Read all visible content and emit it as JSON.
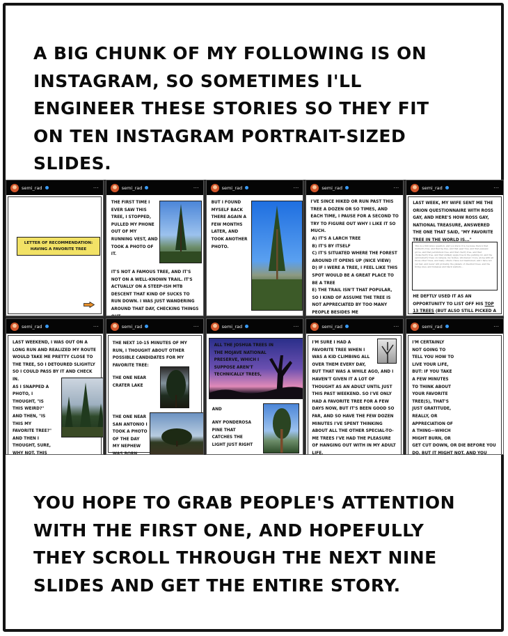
{
  "caption_top": "A big chunk of my following is on Instagram, so sometimes I'll engineer these stories so they fit on ten Instagram portrait-sized slides.",
  "caption_bottom": "You hope to grab people's attention with the first one, and hopefully they scroll through the next nine slides and get the entire story.",
  "instagram": {
    "username": "semi_rad",
    "verified": true,
    "more_icon": "⋯"
  },
  "slides": [
    {
      "title_line1": "Letter of recommendation:",
      "title_line2": "Having a favorite tree",
      "next_icon": "arrow-right"
    },
    {
      "text_a": "The first time I ever saw this tree, I stopped, pulled my phone out of my running vest, and took a photo of it.",
      "text_b": "It's not a famous tree, and it's not on a well-known trail. It's actually on a steep-ish MTB descent that kind of sucks to run down. I was just wandering around that day, checking things out."
    },
    {
      "text_a": "But I found myself back there again a few months later, and took another photo."
    },
    {
      "intro": "I've since hiked or run past this tree a dozen or so times, and each time, I pause for a second to try to figure out why I like it so much.",
      "reasons": [
        "A) It's a larch tree",
        "B) It's by itself",
        "C) It's situated where the forest around it opens up (nice view)",
        "D) If I were a tree, I feel like this spot would be a great place to be a tree",
        "E) The trail isn't that popular, so I kind of assume the tree is not appreciated by too many people besides me"
      ]
    },
    {
      "text_a": "Last week, my wife sent me the Orion questionnaire with Ross Gay, and here's how Ross Gay, national treasure, answered the one that said, \"My favorite tree in the world is...\"",
      "quote": "This is a ridiculous question, and you know it is, because there's that mulberry tree, and that fig tree, and that pear tree, and that pawpaw grove, and that persimmon tree, and that cherry tree, and that chokecherry tree, and that unlikely apple tree in the parking lot, and the serviceberry trees on campus, my hodies, whomever, I love, along with all those other trees, and many others I have not mentioned, and I have not yet met, and never will probably, the planets of chestnut trees, and the living ones, and hulasses and black walnuts...",
      "text_b_1": "He deftly used it as an opportunity to list off his ",
      "text_b_ul": "top 13 trees",
      "text_b_2": " (but also still picked a favorite)."
    },
    {
      "text_a": "Last weekend, I was out on a long run and realized my route would take me pretty close to the tree, so I detoured slightly so I could pass by it and check in.",
      "text_b": "As I snapped a photo, I thought, \"Is this weird?\" and then, \"Is this my favorite tree?\" and then I thought, sure, why not. This is my favorite tree."
    },
    {
      "text_a": "The next 10-15 minutes of my run, I thought about other possible candidates for my favorite tree:",
      "candidate_1": "The one near Crater Lake",
      "candidate_2": "The one near San Antonio I took a photo of the day my nephew was born"
    },
    {
      "text_a": "All the Joshua trees in the Mojave National Preserve, which I suppose aren't technically trees,",
      "text_and": "and",
      "text_b": "any Ponderosa pine that catches the light just right"
    },
    {
      "text_a": "I'm sure I had a favorite tree when I was a kid climbing all over them every day, but that was a while ago, and I haven't given it a lot of thought as an adult until just this past weekend. So I've only had a favorite tree for a few days now, but it's been good so far, and so have the few dozen minutes I've spent thinking about all the other special-to-me trees I've had the pleasure of hanging out with in my adult life."
    },
    {
      "text_a": "I'm certainly not going to tell you how to live your life, but: if you take a few minutes to think about your favorite tree(s), that's just gratitude, really, or appreciation of a thing—which might burn, or get cut down, or die before you do, but it might not, and you might be able to check in on it every year, or every few months, and introduce it to a friend of yours (or two), and maybe that's not a bad way to spend a little bit of your life."
    }
  ],
  "colors": {
    "title_card": "#f2e266",
    "arrow": "#e8902a",
    "header_bg": "#050505",
    "verified": "#3b9cf5"
  }
}
